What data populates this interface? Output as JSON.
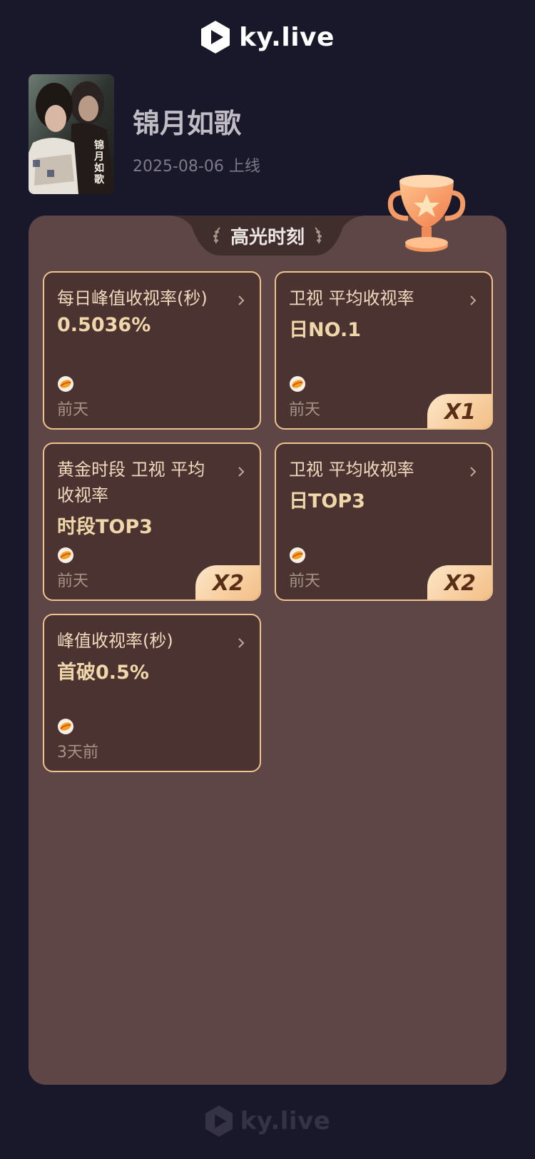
{
  "brand": {
    "name": "ky.live",
    "icon": "ky-live-logo-icon"
  },
  "show": {
    "title": "锦月如歌",
    "release": "2025-08-06 上线",
    "poster_text": "锦月如歌"
  },
  "panel": {
    "title": "高光时刻",
    "trophy_icon": "trophy-icon"
  },
  "colors": {
    "background": "#19172a",
    "panel": "#5d4645",
    "card": "#4b3331",
    "card_border": "#f0c28e",
    "value_text": "#f0d7aa",
    "badge_start": "#fde7c8",
    "badge_end": "#f3bd84"
  },
  "cards": [
    {
      "title": "每日峰值收视率(秒)",
      "value": "0.5036%",
      "time": "前天",
      "badge": "",
      "source_icon": "tv-channel-icon"
    },
    {
      "title": "卫视 平均收视率",
      "value": "日NO.1",
      "time": "前天",
      "badge": "X1",
      "source_icon": "tv-channel-icon"
    },
    {
      "title": "黄金时段 卫视 平均收视率",
      "value": "时段TOP3",
      "time": "前天",
      "badge": "X2",
      "source_icon": "tv-channel-icon"
    },
    {
      "title": "卫视 平均收视率",
      "value": "日TOP3",
      "time": "前天",
      "badge": "X2",
      "source_icon": "tv-channel-icon"
    },
    {
      "title": "峰值收视率(秒)",
      "value": "首破0.5%",
      "time": "3天前",
      "badge": "",
      "source_icon": "tv-channel-icon"
    }
  ],
  "footer": {
    "brand": "ky.live"
  }
}
